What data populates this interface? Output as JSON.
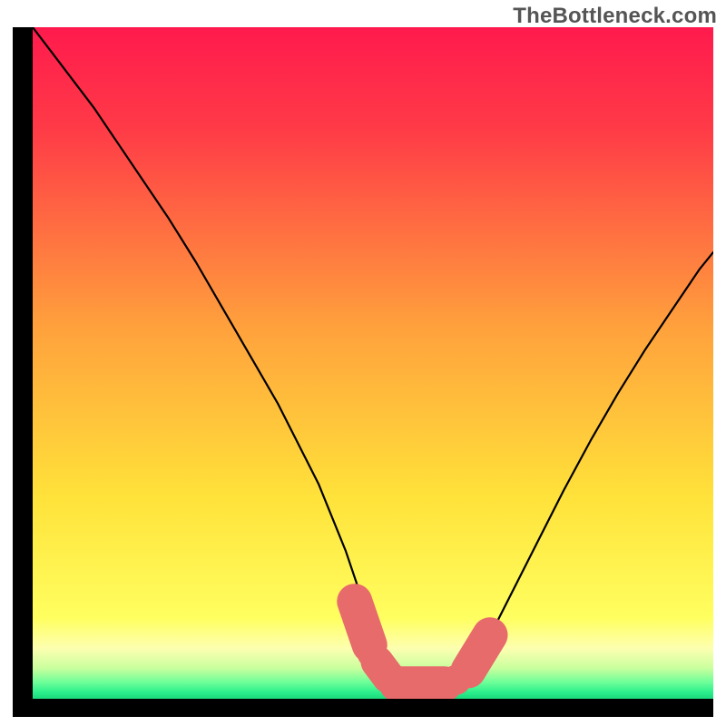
{
  "watermark": "TheBottleneck.com",
  "chart_data": {
    "type": "line",
    "title": "",
    "xlabel": "",
    "ylabel": "",
    "xlim": [
      0,
      100
    ],
    "ylim": [
      0,
      100
    ],
    "gradient_stops": [
      {
        "offset": 0.0,
        "color": "#ff1a4d"
      },
      {
        "offset": 0.15,
        "color": "#ff3a47"
      },
      {
        "offset": 0.45,
        "color": "#ffa23c"
      },
      {
        "offset": 0.7,
        "color": "#ffe23a"
      },
      {
        "offset": 0.88,
        "color": "#ffff60"
      },
      {
        "offset": 0.925,
        "color": "#fdffb0"
      },
      {
        "offset": 0.955,
        "color": "#c8ff9e"
      },
      {
        "offset": 0.975,
        "color": "#6fff99"
      },
      {
        "offset": 0.99,
        "color": "#2cf08c"
      },
      {
        "offset": 1.0,
        "color": "#1ad87c"
      }
    ],
    "series": [
      {
        "name": "curve",
        "color": "#000000",
        "stroke_width": 2.2,
        "x": [
          0.0,
          3,
          6,
          9,
          12,
          16,
          20,
          24,
          28,
          32,
          36,
          40,
          42,
          44,
          46,
          48,
          50,
          52,
          55,
          57,
          60,
          62,
          64,
          66,
          70,
          74,
          78,
          82,
          86,
          90,
          94,
          98,
          100
        ],
        "y": [
          100,
          96,
          92,
          88,
          83.5,
          77.5,
          71.5,
          65,
          58,
          51,
          44,
          36,
          32,
          27,
          22,
          16,
          10,
          5.5,
          2.8,
          2,
          2,
          2.6,
          4,
          7,
          15,
          23,
          31,
          38.5,
          45.5,
          52,
          58,
          64,
          66.5
        ]
      }
    ],
    "markers": {
      "color": "#e76b6b",
      "stroke": "#e76b6b",
      "capsules": [
        {
          "x1": 47.3,
          "y1": 14.5,
          "x2": 49.5,
          "y2": 8.0,
          "r": 2.6
        },
        {
          "x1": 50.6,
          "y1": 5.5,
          "x2": 52.3,
          "y2": 3.2,
          "r": 2.4
        },
        {
          "x1": 53.5,
          "y1": 2.2,
          "x2": 60.5,
          "y2": 2.2,
          "r": 2.6
        },
        {
          "x1": 64.0,
          "y1": 4.2,
          "x2": 67.2,
          "y2": 9.5,
          "r": 2.6
        }
      ],
      "dots": [
        {
          "x": 49.8,
          "y": 6.7,
          "r": 2.1
        },
        {
          "x": 62.2,
          "y": 2.8,
          "r": 2.2
        }
      ]
    }
  }
}
